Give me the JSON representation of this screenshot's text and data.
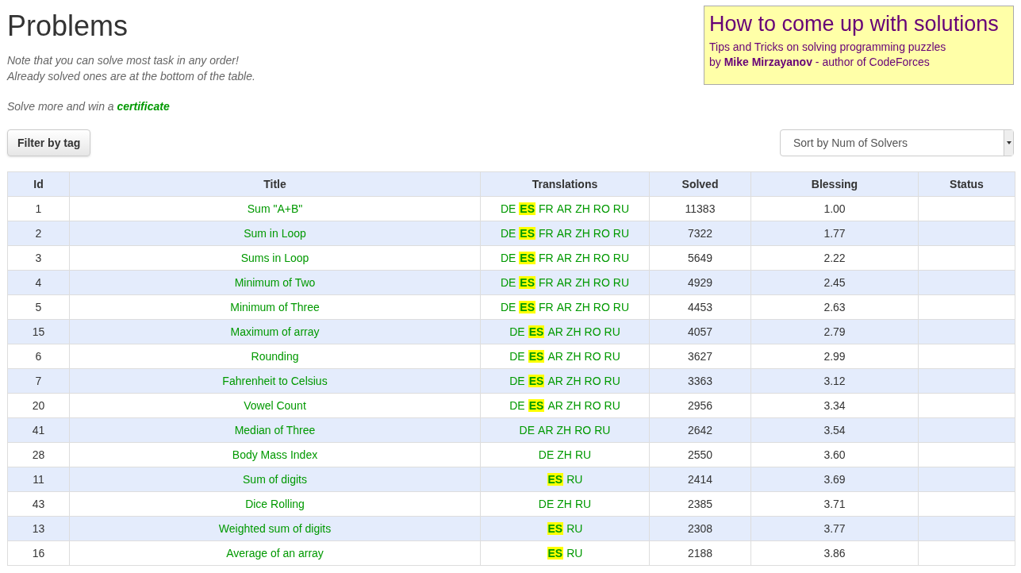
{
  "page_title": "Problems",
  "notes": [
    "Note that you can solve most task in any order!",
    "Already solved ones are at the bottom of the table."
  ],
  "certificate": {
    "text": "Solve more and win a",
    "link": "certificate"
  },
  "promo": {
    "title": "How to come up with solutions",
    "lines": [
      "Tips and Tricks on solving programming puzzles",
      "by **Mike Mirzayanov** - author of CodeForces"
    ]
  },
  "filter_button": "Filter by tag",
  "sort_select": {
    "value": "Sort by Num of Solvers"
  },
  "table": {
    "columns": [
      "Id",
      "Title",
      "Translations",
      "Solved",
      "Blessing",
      "Status"
    ],
    "rows": [
      {
        "id": "1",
        "title": "Sum \"A+B\"",
        "translations": [
          {
            "code": "DE",
            "highlighted": false
          },
          {
            "code": "ES",
            "highlighted": true
          },
          {
            "code": "FR",
            "highlighted": false
          },
          {
            "code": "AR",
            "highlighted": false
          },
          {
            "code": "ZH",
            "highlighted": false
          },
          {
            "code": "RO",
            "highlighted": false
          },
          {
            "code": "RU",
            "highlighted": false
          }
        ],
        "solved": "11383",
        "blessing": "1.00"
      },
      {
        "id": "2",
        "title": "Sum in Loop",
        "translations": [
          {
            "code": "DE",
            "highlighted": false
          },
          {
            "code": "ES",
            "highlighted": true
          },
          {
            "code": "FR",
            "highlighted": false
          },
          {
            "code": "AR",
            "highlighted": false
          },
          {
            "code": "ZH",
            "highlighted": false
          },
          {
            "code": "RO",
            "highlighted": false
          },
          {
            "code": "RU",
            "highlighted": false
          }
        ],
        "solved": "7322",
        "blessing": "1.77"
      },
      {
        "id": "3",
        "title": "Sums in Loop",
        "translations": [
          {
            "code": "DE",
            "highlighted": false
          },
          {
            "code": "ES",
            "highlighted": true
          },
          {
            "code": "FR",
            "highlighted": false
          },
          {
            "code": "AR",
            "highlighted": false
          },
          {
            "code": "ZH",
            "highlighted": false
          },
          {
            "code": "RO",
            "highlighted": false
          },
          {
            "code": "RU",
            "highlighted": false
          }
        ],
        "solved": "5649",
        "blessing": "2.22"
      },
      {
        "id": "4",
        "title": "Minimum of Two",
        "translations": [
          {
            "code": "DE",
            "highlighted": false
          },
          {
            "code": "ES",
            "highlighted": true
          },
          {
            "code": "FR",
            "highlighted": false
          },
          {
            "code": "AR",
            "highlighted": false
          },
          {
            "code": "ZH",
            "highlighted": false
          },
          {
            "code": "RO",
            "highlighted": false
          },
          {
            "code": "RU",
            "highlighted": false
          }
        ],
        "solved": "4929",
        "blessing": "2.45"
      },
      {
        "id": "5",
        "title": "Minimum of Three",
        "translations": [
          {
            "code": "DE",
            "highlighted": false
          },
          {
            "code": "ES",
            "highlighted": true
          },
          {
            "code": "FR",
            "highlighted": false
          },
          {
            "code": "AR",
            "highlighted": false
          },
          {
            "code": "ZH",
            "highlighted": false
          },
          {
            "code": "RO",
            "highlighted": false
          },
          {
            "code": "RU",
            "highlighted": false
          }
        ],
        "solved": "4453",
        "blessing": "2.63"
      },
      {
        "id": "15",
        "title": "Maximum of array",
        "translations": [
          {
            "code": "DE",
            "highlighted": false
          },
          {
            "code": "ES",
            "highlighted": true
          },
          {
            "code": "AR",
            "highlighted": false
          },
          {
            "code": "ZH",
            "highlighted": false
          },
          {
            "code": "RO",
            "highlighted": false
          },
          {
            "code": "RU",
            "highlighted": false
          }
        ],
        "solved": "4057",
        "blessing": "2.79"
      },
      {
        "id": "6",
        "title": "Rounding",
        "translations": [
          {
            "code": "DE",
            "highlighted": false
          },
          {
            "code": "ES",
            "highlighted": true
          },
          {
            "code": "AR",
            "highlighted": false
          },
          {
            "code": "ZH",
            "highlighted": false
          },
          {
            "code": "RO",
            "highlighted": false
          },
          {
            "code": "RU",
            "highlighted": false
          }
        ],
        "solved": "3627",
        "blessing": "2.99"
      },
      {
        "id": "7",
        "title": "Fahrenheit to Celsius",
        "translations": [
          {
            "code": "DE",
            "highlighted": false
          },
          {
            "code": "ES",
            "highlighted": true
          },
          {
            "code": "AR",
            "highlighted": false
          },
          {
            "code": "ZH",
            "highlighted": false
          },
          {
            "code": "RO",
            "highlighted": false
          },
          {
            "code": "RU",
            "highlighted": false
          }
        ],
        "solved": "3363",
        "blessing": "3.12"
      },
      {
        "id": "20",
        "title": "Vowel Count",
        "translations": [
          {
            "code": "DE",
            "highlighted": false
          },
          {
            "code": "ES",
            "highlighted": true
          },
          {
            "code": "AR",
            "highlighted": false
          },
          {
            "code": "ZH",
            "highlighted": false
          },
          {
            "code": "RO",
            "highlighted": false
          },
          {
            "code": "RU",
            "highlighted": false
          }
        ],
        "solved": "2956",
        "blessing": "3.34"
      },
      {
        "id": "41",
        "title": "Median of Three",
        "translations": [
          {
            "code": "DE",
            "highlighted": false
          },
          {
            "code": "AR",
            "highlighted": false
          },
          {
            "code": "ZH",
            "highlighted": false
          },
          {
            "code": "RO",
            "highlighted": false
          },
          {
            "code": "RU",
            "highlighted": false
          }
        ],
        "solved": "2642",
        "blessing": "3.54"
      },
      {
        "id": "28",
        "title": "Body Mass Index",
        "translations": [
          {
            "code": "DE",
            "highlighted": false
          },
          {
            "code": "ZH",
            "highlighted": false
          },
          {
            "code": "RU",
            "highlighted": false
          }
        ],
        "solved": "2550",
        "blessing": "3.60"
      },
      {
        "id": "11",
        "title": "Sum of digits",
        "translations": [
          {
            "code": "ES",
            "highlighted": true
          },
          {
            "code": "RU",
            "highlighted": false
          }
        ],
        "solved": "2414",
        "blessing": "3.69"
      },
      {
        "id": "43",
        "title": "Dice Rolling",
        "translations": [
          {
            "code": "DE",
            "highlighted": false
          },
          {
            "code": "ZH",
            "highlighted": false
          },
          {
            "code": "RU",
            "highlighted": false
          }
        ],
        "solved": "2385",
        "blessing": "3.71"
      },
      {
        "id": "13",
        "title": "Weighted sum of digits",
        "translations": [
          {
            "code": "ES",
            "highlighted": true
          },
          {
            "code": "RU",
            "highlighted": false
          }
        ],
        "solved": "2308",
        "blessing": "3.77"
      },
      {
        "id": "16",
        "title": "Average of an array",
        "translations": [
          {
            "code": "ES",
            "highlighted": true
          },
          {
            "code": "RU",
            "highlighted": false
          }
        ],
        "solved": "2188",
        "blessing": "3.86"
      }
    ]
  }
}
